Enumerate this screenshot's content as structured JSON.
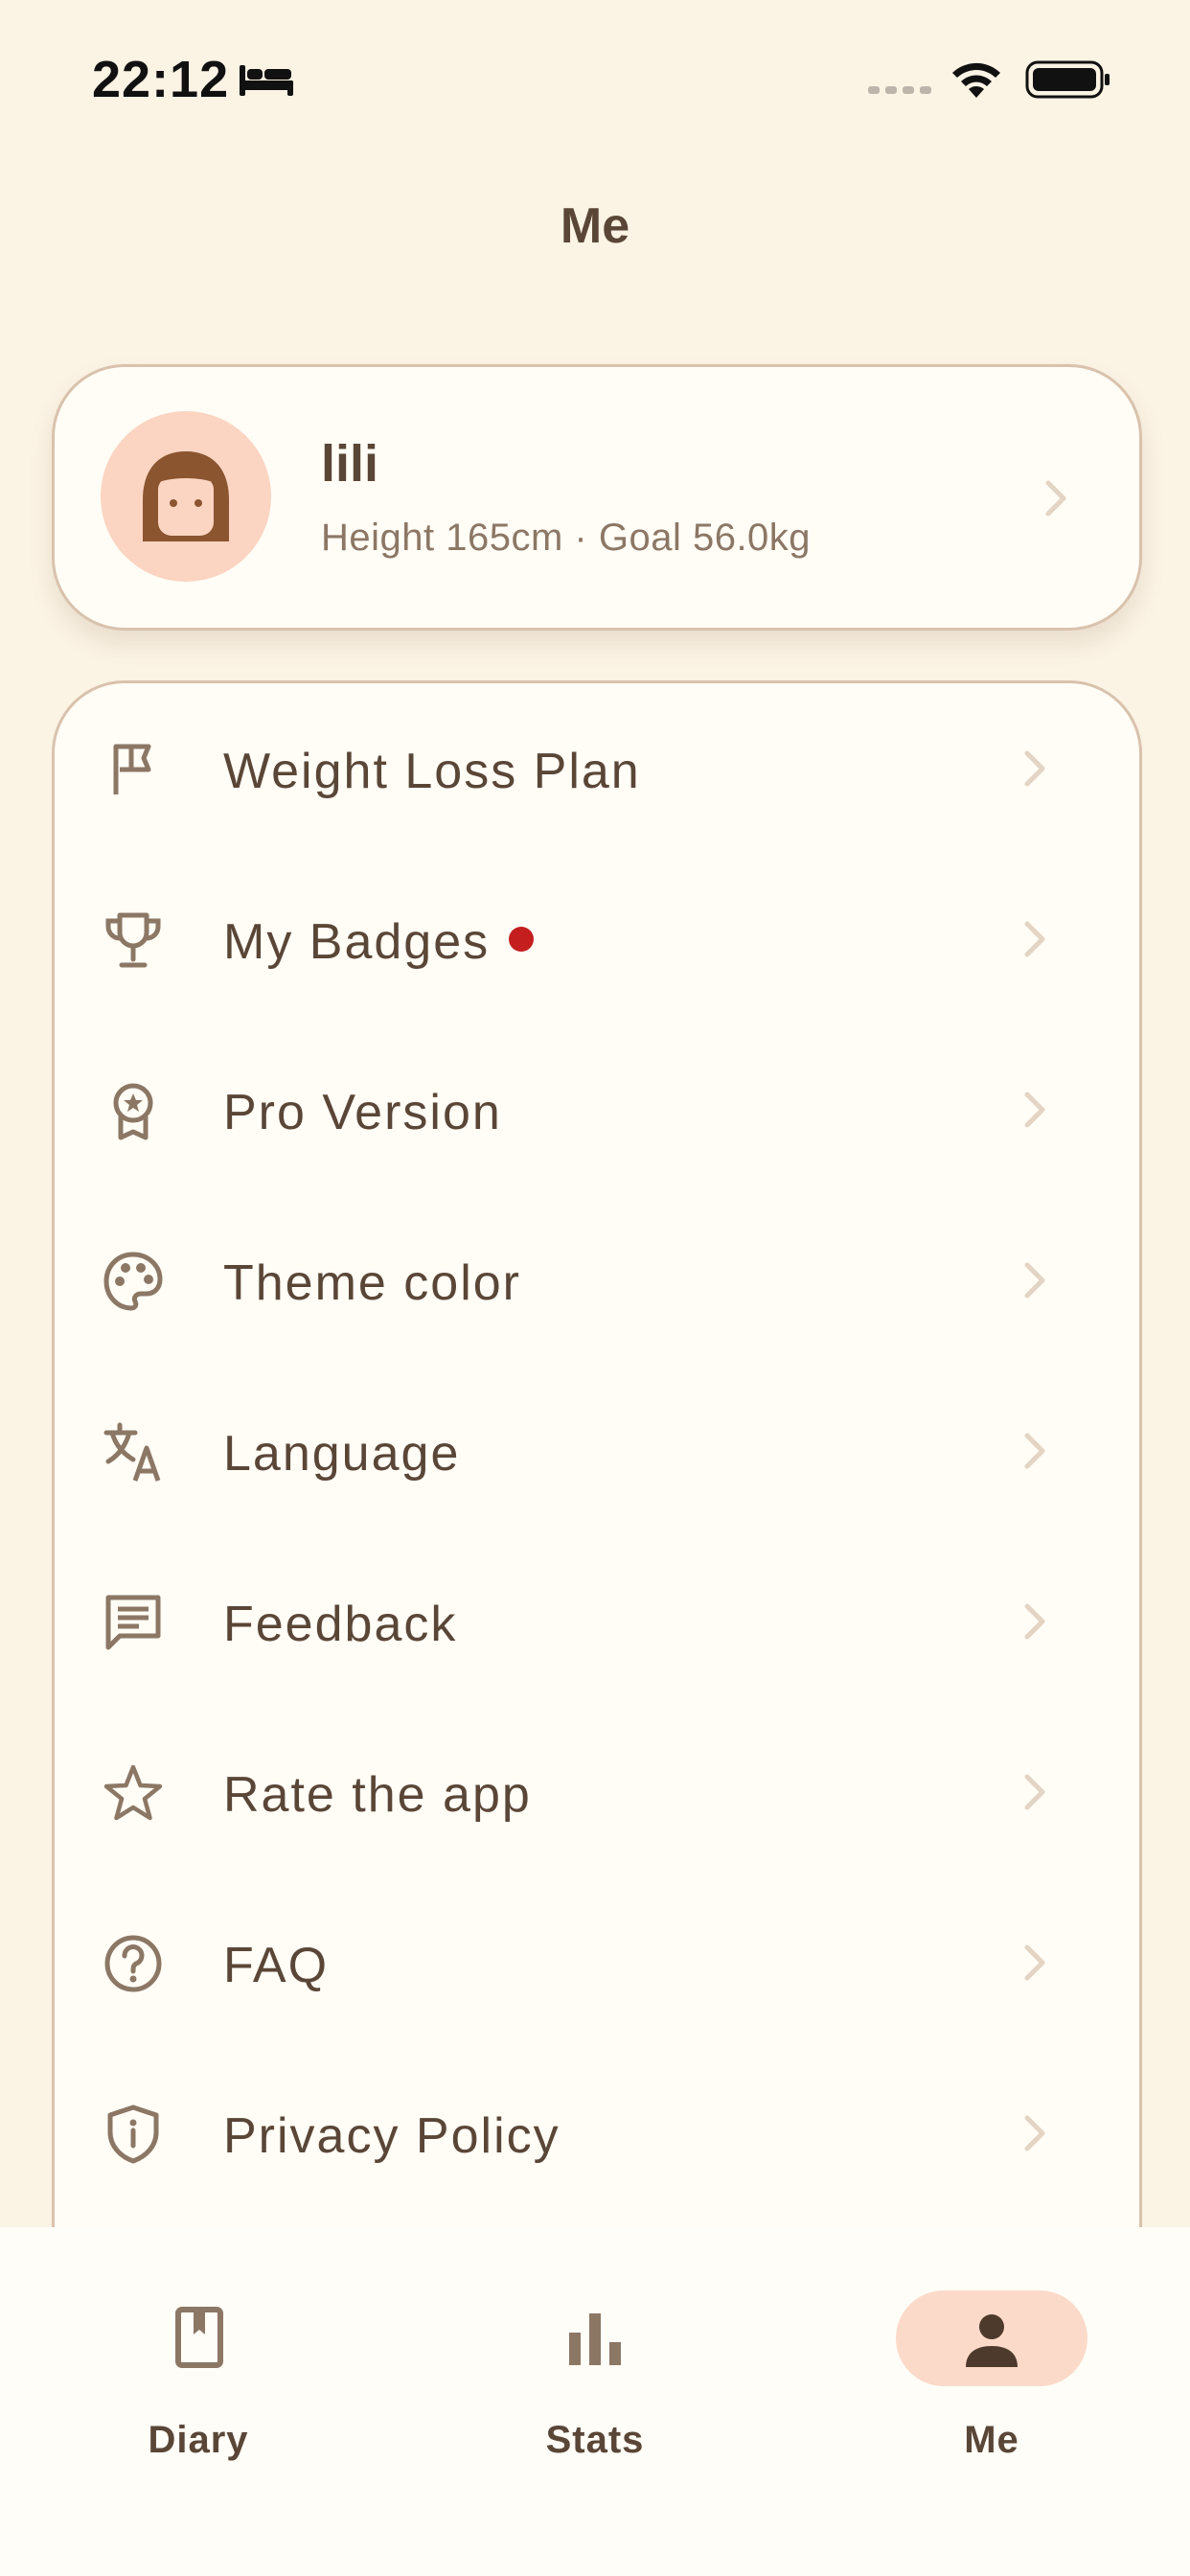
{
  "status_bar": {
    "time": "22:12"
  },
  "header": {
    "title": "Me"
  },
  "profile": {
    "name": "lili",
    "subtitle": "Height 165cm · Goal 56.0kg"
  },
  "menu": [
    {
      "label": "Weight Loss Plan",
      "icon": "flag-icon"
    },
    {
      "label": "My Badges",
      "icon": "trophy-icon",
      "badge": true
    },
    {
      "label": "Pro Version",
      "icon": "award-icon"
    },
    {
      "label": "Theme color",
      "icon": "palette-icon"
    },
    {
      "label": "Language",
      "icon": "translate-icon"
    },
    {
      "label": "Feedback",
      "icon": "feedback-icon"
    },
    {
      "label": "Rate the app",
      "icon": "star-icon"
    },
    {
      "label": "FAQ",
      "icon": "help-icon"
    },
    {
      "label": "Privacy Policy",
      "icon": "shield-icon"
    }
  ],
  "bottom_nav": [
    {
      "label": "Diary",
      "icon": "book-icon",
      "active": false
    },
    {
      "label": "Stats",
      "icon": "bar-chart-icon",
      "active": false
    },
    {
      "label": "Me",
      "icon": "person-icon",
      "active": true
    }
  ],
  "colors": {
    "background": "#FBF3E4",
    "card": "#FFFDF6",
    "border": "#D9C2AD",
    "text": "#5A4637",
    "accent_pill": "#FCDAC9",
    "badge_dot": "#C41E1E"
  }
}
